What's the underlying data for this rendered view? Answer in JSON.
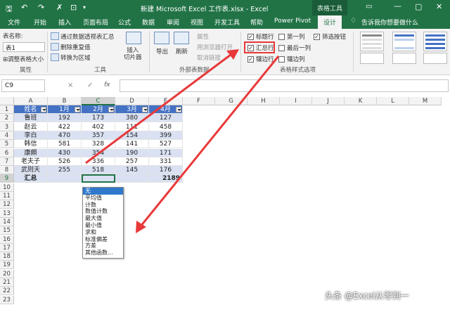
{
  "window": {
    "title": "新建 Microsoft Excel 工作表.xlsx  -  Excel",
    "context_tab": "表格工具",
    "qat": [
      "save-icon",
      "undo-icon",
      "redo-icon",
      "clear-format-icon",
      "camera-icon",
      "dropdown-icon"
    ],
    "controls": [
      "ribbon-display-icon",
      "minimize-icon",
      "maximize-icon",
      "close-icon"
    ]
  },
  "tabs": [
    "文件",
    "开始",
    "插入",
    "页面布局",
    "公式",
    "数据",
    "审阅",
    "视图",
    "开发工具",
    "帮助",
    "Power Pivot",
    "设计"
  ],
  "active_tab": "设计",
  "tell_me": "告诉我你想要做什么",
  "ribbon": {
    "table_name_label": "表名称:",
    "table_name_value": "表1",
    "resize_table": "调整表格大小",
    "group_properties": "属性",
    "summarize_pivot": "通过数据透视表汇总",
    "remove_duplicates": "删除重复值",
    "convert_to_range": "转换为区域",
    "insert_slicer": "插入\n切片器",
    "group_tools": "工具",
    "export": "导出",
    "refresh": "刷新",
    "properties": "属性",
    "open_in_browser": "用浏览器打开",
    "unlink": "取消链接",
    "group_external": "外部表数据",
    "options": [
      {
        "label": "标题行",
        "checked": true
      },
      {
        "label": "第一列",
        "checked": false
      },
      {
        "label": "筛选按钮",
        "checked": true
      },
      {
        "label": "汇总行",
        "checked": true
      },
      {
        "label": "最后一列",
        "checked": false
      },
      {
        "label": "镶边行",
        "checked": true
      },
      {
        "label": "镶边列",
        "checked": false
      }
    ],
    "group_style_options": "表格样式选项",
    "accent": "#217346"
  },
  "formula_bar": {
    "namebox": "C9",
    "cancel": "×",
    "enter": "✓",
    "fx": "fx",
    "content": ""
  },
  "sheet": {
    "columns": [
      "A",
      "B",
      "C",
      "D",
      "E",
      "F",
      "G",
      "H",
      "I",
      "J",
      "K",
      "L",
      "M"
    ],
    "selected_column": "C",
    "rows": [
      "1",
      "2",
      "3",
      "4",
      "5",
      "6",
      "7",
      "8",
      "9",
      "10",
      "11",
      "12",
      "13",
      "14",
      "15",
      "16",
      "17",
      "18",
      "19",
      "20",
      "21",
      "22",
      "23"
    ],
    "selected_row": "9",
    "headers": [
      "姓名",
      "1月",
      "2月",
      "3月",
      "4月"
    ],
    "data": [
      [
        "鲁班",
        "192",
        "173",
        "380",
        "127"
      ],
      [
        "赵云",
        "422",
        "402",
        "111",
        "458"
      ],
      [
        "李白",
        "470",
        "357",
        "154",
        "399"
      ],
      [
        "韩信",
        "581",
        "328",
        "141",
        "527"
      ],
      [
        "康頗",
        "430",
        "354",
        "190",
        "171"
      ],
      [
        "老夫子",
        "526",
        "336",
        "257",
        "331"
      ],
      [
        "武则天",
        "255",
        "518",
        "145",
        "176"
      ]
    ],
    "total_label": "汇总",
    "total_value": "2189",
    "header_color": "#4472c4",
    "band_color": "#d9e1f2"
  },
  "dropdown": {
    "items": [
      "无",
      "平均值",
      "计数",
      "数值计数",
      "最大值",
      "最小值",
      "求和",
      "标准偏差",
      "方差",
      "其他函数..."
    ],
    "selected": "无"
  },
  "watermark": "头条 @Excel从零到一",
  "annotation_color": "#e8393a"
}
